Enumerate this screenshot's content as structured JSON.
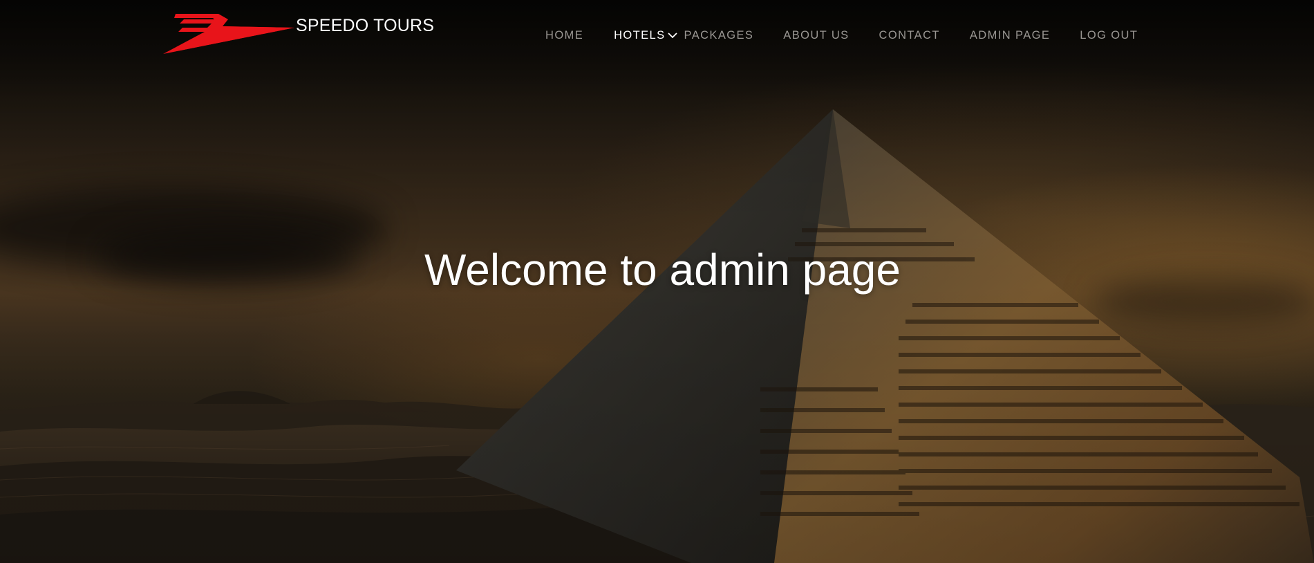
{
  "brand": {
    "name": "SPEEDO TOURS",
    "logo_icon": "speedo-wing-logo-icon",
    "logo_color": "#e8141a"
  },
  "nav": {
    "items": [
      {
        "label": "HOME",
        "active": false
      },
      {
        "label": "HOTELS",
        "active": true,
        "dropdown_icon": "chevron-down-icon"
      },
      {
        "label": "PACKAGES",
        "active": false
      },
      {
        "label": "ABOUT US",
        "active": false
      },
      {
        "label": "CONTACT",
        "active": false
      },
      {
        "label": "ADMIN PAGE",
        "active": false
      },
      {
        "label": "LOG OUT",
        "active": false
      }
    ],
    "text_color": "#9a9793",
    "active_color": "#ffffff"
  },
  "hero": {
    "title": "Welcome to admin page",
    "background": "pyramid-desert-dusk-image"
  }
}
